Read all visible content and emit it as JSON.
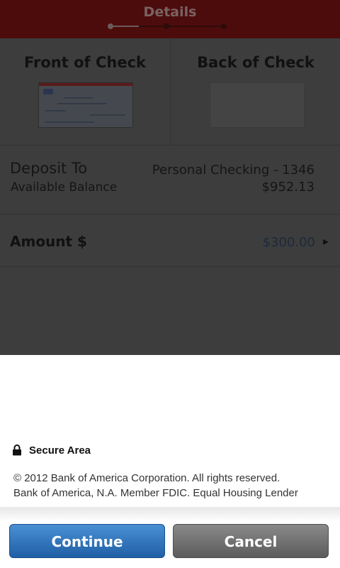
{
  "header": {
    "title": "Details",
    "progress": {
      "steps": 3,
      "current_step": 1
    }
  },
  "checks": {
    "front_label": "Front of Check",
    "back_label": "Back of Check"
  },
  "deposit": {
    "label": "Deposit To",
    "balance_label": "Available Balance",
    "account": "Personal Checking - 1346",
    "balance": "$952.13"
  },
  "amount": {
    "label": "Amount $",
    "value": "$300.00"
  },
  "footer": {
    "secure_label": "Secure Area",
    "legal_line1": "© 2012  Bank of America Corporation. All rights reserved.",
    "legal_line2": "Bank of America, N.A. Member FDIC. Equal Housing Lender"
  },
  "buttons": {
    "continue_label": "Continue",
    "cancel_label": "Cancel"
  },
  "icons": {
    "lock": "lock-icon",
    "chevron": "chevron-right-icon"
  },
  "colors": {
    "header_bg": "#4d0c0c",
    "continue_button": "#2a6fb8",
    "cancel_button": "#707070"
  }
}
